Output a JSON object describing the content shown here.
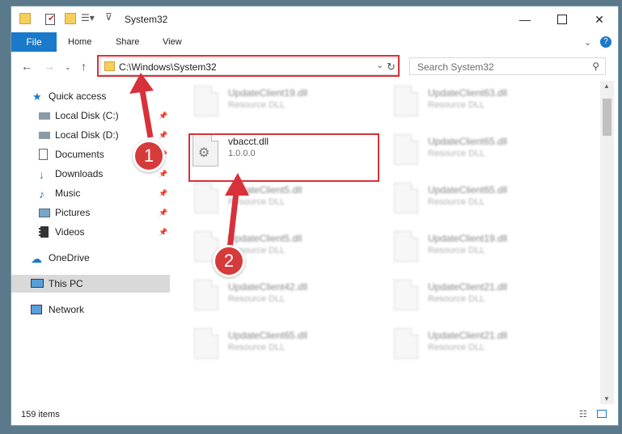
{
  "window": {
    "title": "System32"
  },
  "ribbon": {
    "tabs": [
      "File",
      "Home",
      "Share",
      "View"
    ]
  },
  "address": {
    "path": "C:\\Windows\\System32"
  },
  "search": {
    "placeholder": "Search System32"
  },
  "sidebar": {
    "items": [
      {
        "label": "Quick access",
        "icon": "star-icon"
      },
      {
        "label": "Local Disk (C:)",
        "icon": "drive-icon"
      },
      {
        "label": "Local Disk (D:)",
        "icon": "drive-icon"
      },
      {
        "label": "Documents",
        "icon": "documents-icon"
      },
      {
        "label": "Downloads",
        "icon": "download-icon"
      },
      {
        "label": "Music",
        "icon": "music-icon"
      },
      {
        "label": "Pictures",
        "icon": "pictures-icon"
      },
      {
        "label": "Videos",
        "icon": "videos-icon"
      },
      {
        "label": "OneDrive",
        "icon": "cloud-icon"
      },
      {
        "label": "This PC",
        "icon": "computer-icon"
      },
      {
        "label": "Network",
        "icon": "network-icon"
      }
    ]
  },
  "files": [
    {
      "name": "UpdateClient19.dll",
      "sub": "Resource DLL"
    },
    {
      "name": "UpdateClient63.dll",
      "sub": "Resource DLL"
    },
    {
      "name": "vbacct.dll",
      "sub": "1.0.0.0"
    },
    {
      "name": "UpdateClient65.dll",
      "sub": "Resource DLL"
    },
    {
      "name": "UpdateClient5.dll",
      "sub": "Resource DLL"
    },
    {
      "name": "UpdateClient65.dll",
      "sub": "Resource DLL"
    },
    {
      "name": "UpdateClient5.dll",
      "sub": "Resource DLL"
    },
    {
      "name": "UpdateClient19.dll",
      "sub": "Resource DLL"
    },
    {
      "name": "UpdateClient42.dll",
      "sub": "Resource DLL"
    },
    {
      "name": "UpdateClient21.dll",
      "sub": "Resource DLL"
    },
    {
      "name": "UpdateClient65.dll",
      "sub": "Resource DLL"
    },
    {
      "name": "UpdateClient21.dll",
      "sub": "Resource DLL"
    }
  ],
  "status": {
    "count": "159 items"
  },
  "annotations": {
    "step1": "1",
    "step2": "2"
  },
  "colors": {
    "accent": "#1979ca",
    "highlight": "#d7313a"
  }
}
